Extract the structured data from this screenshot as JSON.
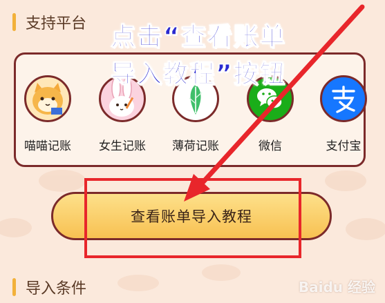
{
  "sections": {
    "platforms_title": "支持平台",
    "conditions_title": "导入条件"
  },
  "platforms": [
    {
      "label": "喵喵记账",
      "icon": "cat-mascot-icon"
    },
    {
      "label": "女生记账",
      "icon": "bunny-mascot-icon"
    },
    {
      "label": "薄荷记账",
      "icon": "mint-leaf-icon"
    },
    {
      "label": "微信",
      "icon": "wechat-icon"
    },
    {
      "label": "支付宝",
      "icon": "alipay-icon"
    }
  ],
  "guide_button": {
    "label": "查看账单导入教程"
  },
  "annotation": {
    "line1": "点击“查看账单",
    "line2": "导入教程”按钮"
  },
  "watermark": {
    "text": "Baidu 经验"
  },
  "colors": {
    "background": "#fbe9dc",
    "accent_bar": "#f2b13a",
    "border": "#7b2a2a",
    "button_fill": "#f8c152",
    "highlight": "#e8262b",
    "callout_text": "#2a2ad0",
    "wechat_green": "#1aad19",
    "alipay_blue": "#1677ff"
  }
}
